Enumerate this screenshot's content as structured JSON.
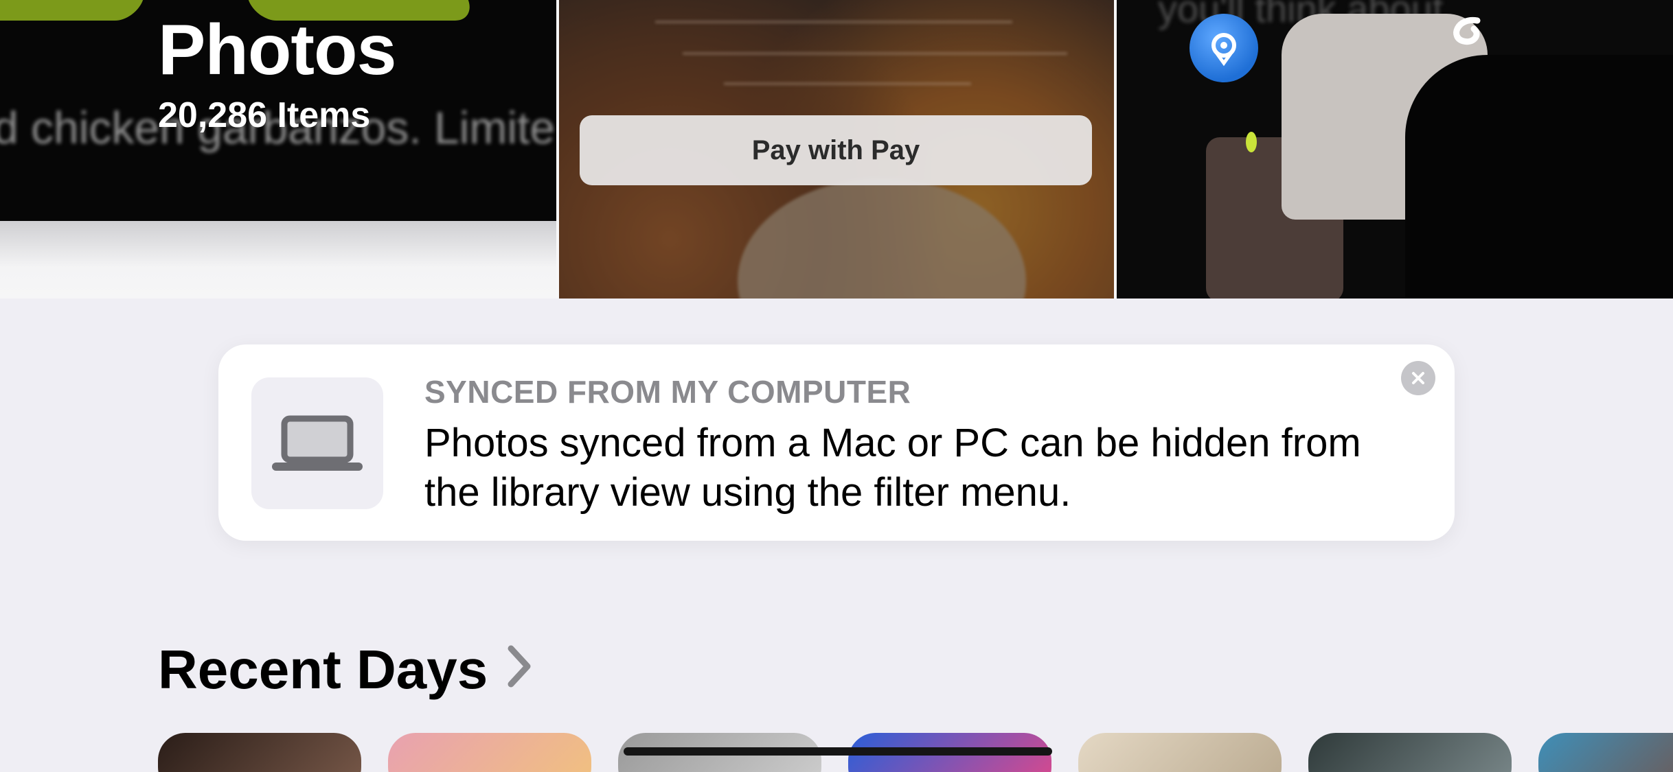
{
  "header": {
    "title": "Photos",
    "item_count": "20,286 Items"
  },
  "top_tiles": [
    {
      "name": "tile-ad-screenshot",
      "blurred_text": "d chicken garbanzos. Limite"
    },
    {
      "name": "tile-food-pay",
      "pay_button_label": "Pay with  Pay"
    },
    {
      "name": "tile-portrait",
      "blurred_text": "you'll think about"
    }
  ],
  "banner": {
    "eyebrow": "SYNCED FROM MY COMPUTER",
    "body": "Photos synced from a Mac or PC can be hidden from the library view using the filter menu.",
    "icon": "laptop-icon",
    "close_icon": "close-icon"
  },
  "recent_days": {
    "title": "Recent Days",
    "chevron_icon": "chevron-right-icon",
    "thumbnails": [
      {
        "colors": [
          "#2a1d18",
          "#7a5a4a"
        ]
      },
      {
        "colors": [
          "#e8a1b0",
          "#f1c27d"
        ]
      },
      {
        "colors": [
          "#9a9a9a",
          "#cfcfcf"
        ]
      },
      {
        "colors": [
          "#2a5fd8",
          "#e0488a"
        ]
      },
      {
        "colors": [
          "#e4d8c4",
          "#b9a98f"
        ]
      },
      {
        "colors": [
          "#2f3a3a",
          "#7c8a8c"
        ]
      },
      {
        "colors": [
          "#3f8fb8",
          "#7a4a3a"
        ]
      }
    ]
  },
  "colors": {
    "background": "#efeef4",
    "banner_bg": "#ffffff",
    "eyebrow": "#8a8a8e",
    "close_button": "#c5c5c9"
  }
}
